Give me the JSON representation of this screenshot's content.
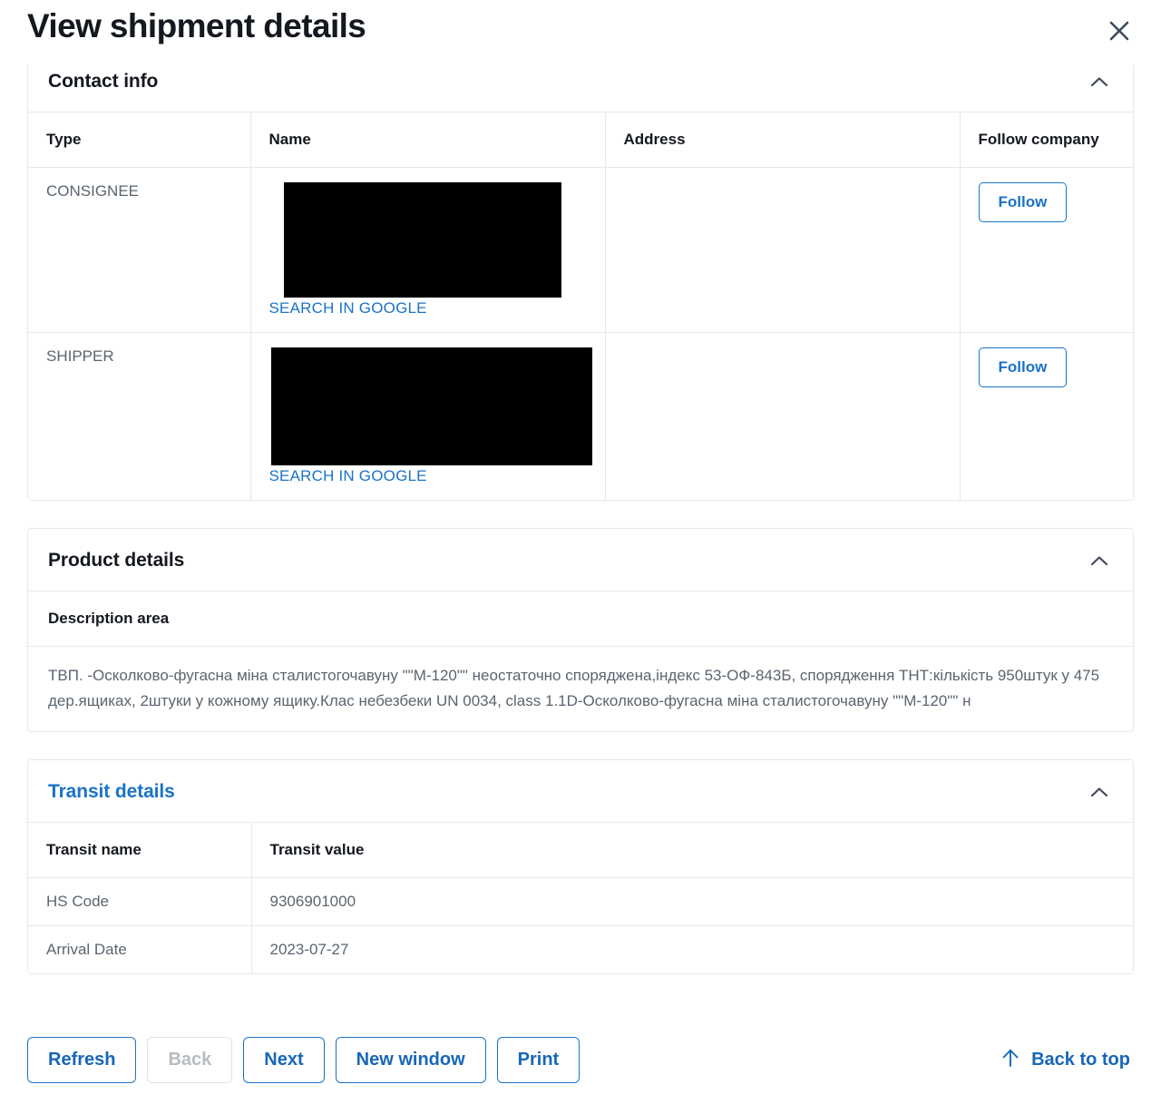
{
  "header": {
    "title": "View shipment details",
    "close_icon": "close-icon"
  },
  "contact_info": {
    "section_title": "Contact info",
    "columns": [
      "Type",
      "Name",
      "Address",
      "Follow company"
    ],
    "rows": [
      {
        "type": "CONSIGNEE",
        "name": "",
        "name_redacted": true,
        "search_link": "SEARCH IN GOOGLE",
        "address": "",
        "follow_label": "Follow"
      },
      {
        "type": "SHIPPER",
        "name": "",
        "name_redacted": true,
        "search_link": "SEARCH IN GOOGLE",
        "address": "",
        "follow_label": "Follow"
      }
    ]
  },
  "product_details": {
    "section_title": "Product details",
    "description_header": "Description area",
    "description": "ТВП. -Осколково-фугасна міна сталистогочавуну \"\"М-120\"\" неостаточно споряджена,індекс 53-ОФ-843Б, спорядження ТНТ:кількість 950штук у 475 дер.ящиках, 2штуки у кожному ящику.Клас небезбеки UN 0034, class 1.1D-Осколково-фугасна міна сталистогочавуну \"\"М-120\"\" н"
  },
  "transit_details": {
    "section_title": "Transit details",
    "columns": [
      "Transit name",
      "Transit value"
    ],
    "rows": [
      {
        "name": "HS Code",
        "value": "9306901000"
      },
      {
        "name": "Arrival Date",
        "value": "2023-07-27"
      }
    ]
  },
  "footer": {
    "buttons": [
      {
        "label": "Refresh",
        "disabled": false
      },
      {
        "label": "Back",
        "disabled": true
      },
      {
        "label": "Next",
        "disabled": false
      },
      {
        "label": "New window",
        "disabled": false
      },
      {
        "label": "Print",
        "disabled": false
      }
    ],
    "back_to_top_label": "Back to top",
    "back_to_top_icon": "arrow-up-icon"
  },
  "colors": {
    "link": "#1a73c7",
    "text": "#14181f",
    "muted": "#5b6570",
    "border": "#e6e8ea",
    "disabled": "#b6bcc2"
  }
}
